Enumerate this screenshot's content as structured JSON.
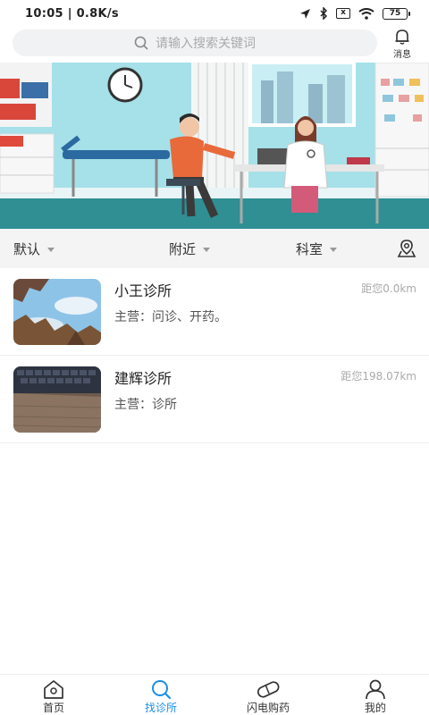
{
  "status": {
    "time_speed": "10:05 | 0.8K/s",
    "battery": "75",
    "x_badge": "x"
  },
  "header": {
    "search_placeholder": "请输入搜索关键词",
    "message_label": "消息"
  },
  "filters": {
    "default_label": "默认",
    "nearby_label": "附近",
    "department_label": "科室"
  },
  "clinics": [
    {
      "name": "小王诊所",
      "distance": "距您0.0km",
      "main_business": "主营：问诊、开药。"
    },
    {
      "name": "建辉诊所",
      "distance": "距您198.07km",
      "main_business": "主营：诊所"
    }
  ],
  "bottom_nav": {
    "home": "首页",
    "find_clinic": "找诊所",
    "flash_medicine": "闪电购药",
    "mine": "我的"
  },
  "colors": {
    "accent": "#1a8fe6",
    "filter_bg": "#f4f4f4",
    "search_bg": "#f1f2f4"
  }
}
